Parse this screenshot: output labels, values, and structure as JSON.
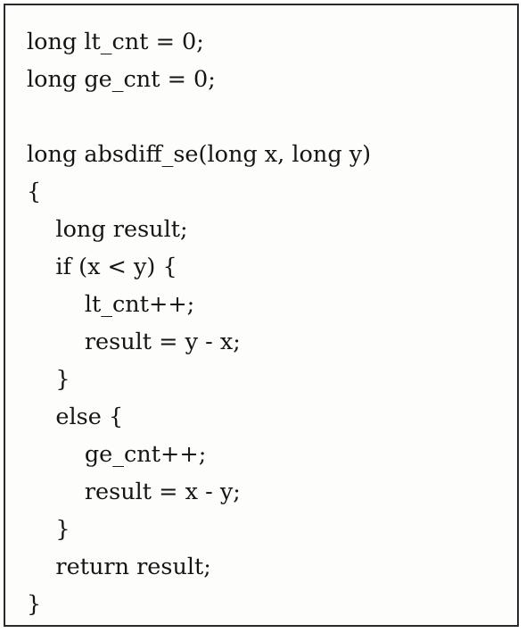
{
  "code": {
    "lines": [
      "long lt_cnt = 0;",
      "long ge_cnt = 0;",
      "",
      "long absdiff_se(long x, long y)",
      "{",
      "    long result;",
      "    if (x < y) {",
      "        lt_cnt++;",
      "        result = y - x;",
      "    }",
      "    else {",
      "        ge_cnt++;",
      "        result = x - y;",
      "    }",
      "    return result;",
      "}"
    ]
  }
}
